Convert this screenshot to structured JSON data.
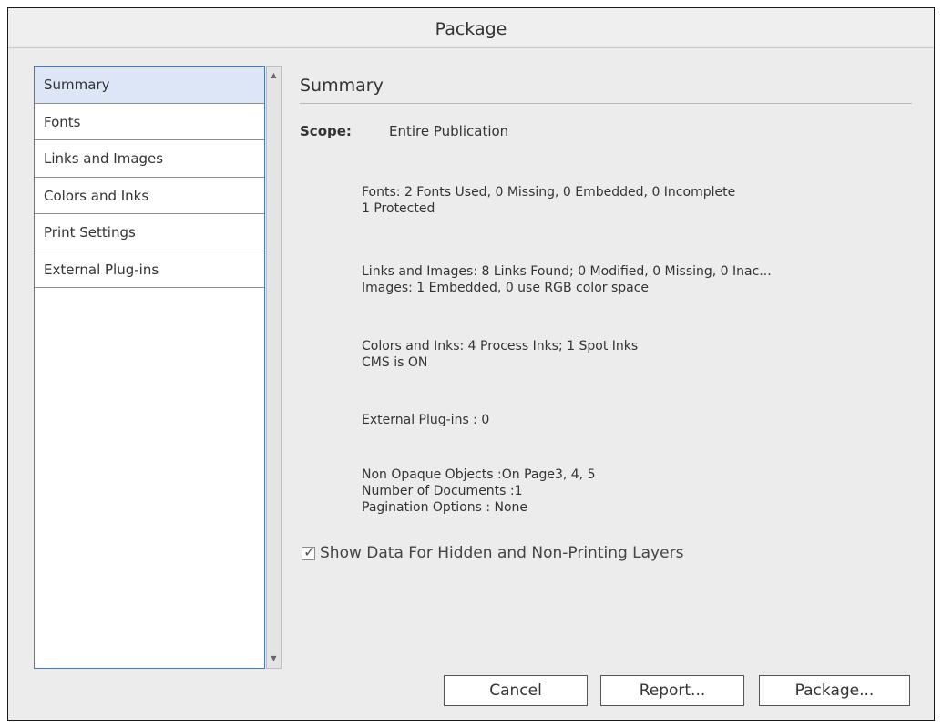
{
  "window": {
    "title": "Package"
  },
  "sidebar": {
    "items": [
      {
        "label": "Summary"
      },
      {
        "label": "Fonts"
      },
      {
        "label": "Links and Images"
      },
      {
        "label": "Colors and Inks"
      },
      {
        "label": "Print Settings"
      },
      {
        "label": "External Plug-ins"
      }
    ],
    "selected": "Summary"
  },
  "summary": {
    "heading": "Summary",
    "scope_label": "Scope:",
    "scope_value": "Entire Publication",
    "fonts": [
      "Fonts: 2 Fonts Used, 0 Missing, 0 Embedded, 0 Incomplete",
      "1 Protected"
    ],
    "links": [
      "Links and Images: 8 Links Found; 0 Modified, 0 Missing, 0 Inac...",
      "Images: 1 Embedded, 0 use RGB color space"
    ],
    "colors": [
      "Colors and Inks: 4 Process Inks; 1 Spot Inks",
      "CMS is ON"
    ],
    "plugins": [
      "External Plug-ins : 0"
    ],
    "other": [
      "Non Opaque Objects :On Page3, 4, 5",
      "Number of Documents :1",
      "Pagination Options : None"
    ]
  },
  "options": {
    "show_hidden_label": "Show Data For Hidden and Non-Printing Layers",
    "show_hidden_checked": true
  },
  "buttons": {
    "cancel": "Cancel",
    "report": "Report...",
    "package": "Package..."
  }
}
